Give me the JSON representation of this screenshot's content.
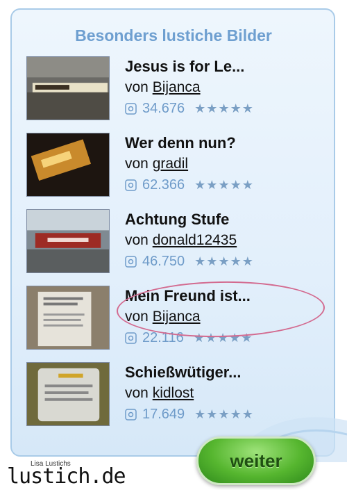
{
  "widget": {
    "title": "Besonders lustiche Bilder",
    "by_prefix": "von",
    "next_button": "weiter",
    "colors": {
      "title": "#6e9fd0",
      "panel_border": "#a9cbe8",
      "button": "#56b62f",
      "oval": "#d36a8f"
    }
  },
  "items": [
    {
      "title": "Jesus is for Le...",
      "author": "Bijanca",
      "views": "34.676",
      "stars": "★★★★★"
    },
    {
      "title": "Wer denn nun?",
      "author": "gradil",
      "views": "62.366",
      "stars": "★★★★★"
    },
    {
      "title": "Achtung Stufe",
      "author": "donald12435",
      "views": "46.750",
      "stars": "★★★★★"
    },
    {
      "title": "Mein Freund ist...",
      "author": "Bijanca",
      "views": "22.116",
      "stars": "★★★★★"
    },
    {
      "title": "Schießwütiger...",
      "author": "kidlost",
      "views": "17.649",
      "stars": "★★★★★"
    }
  ],
  "branding": {
    "small": "Lisa Lustichs",
    "logo": "lustich.de"
  }
}
